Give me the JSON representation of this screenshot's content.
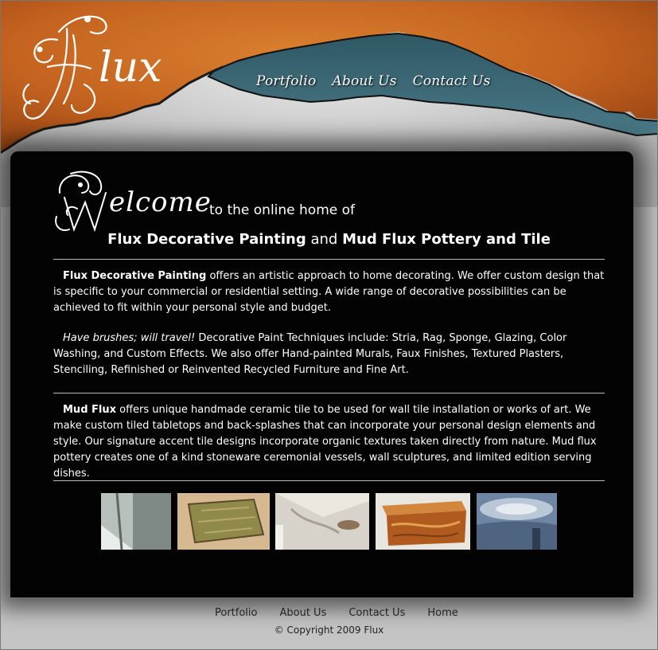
{
  "logo": {
    "text": "Flux",
    "initial": "F",
    "rest": "lux"
  },
  "nav": {
    "items": [
      {
        "label": "Portfolio"
      },
      {
        "label": "About Us"
      },
      {
        "label": "Contact Us"
      }
    ]
  },
  "welcome": {
    "initial": "W",
    "word": "elcome",
    "tail": "to the online home of"
  },
  "headline": {
    "name1": "Flux Decorative Painting",
    "and": "and",
    "name2": "Mud Flux Pottery and Tile"
  },
  "paragraphs": {
    "p1_bold": "Flux Decorative Painting",
    "p1_text": " offers an artistic approach to home decorating. We offer custom design that is specific to your commercial or residential setting. A wide range of decorative possibilities can be achieved to fit within your personal style and budget.",
    "p2_italic": "Have brushes; will travel!",
    "p2_text": " Decorative Paint Techniques include: Stria, Rag, Sponge, Glazing, Color Washing, and Custom Effects. We also offer Hand-painted Murals, Faux Finishes, Textured Plasters, Stenciling, Refinished or Reinvented Recycled Furniture and Fine Art.",
    "p3_bold": "Mud Flux",
    "p3_text": " offers unique handmade ceramic tile to be used for wall tile installation or works of art. We make custom tiled tabletops and back-splashes that can incorporate your personal design elements and style. Our signature accent tile designs incorporate organic textures taken directly from nature. Mud flux pottery creates one of a kind stoneware ceremonial vessels, wall sculptures, and limited edition serving dishes."
  },
  "thumbnails": [
    {
      "name": "stairway-wall-finish"
    },
    {
      "name": "ceramic-tile-piece"
    },
    {
      "name": "mural-ceiling-light"
    },
    {
      "name": "painted-wood-chest"
    },
    {
      "name": "sky-mural-room"
    }
  ],
  "footer": {
    "links": [
      {
        "label": "Portfolio"
      },
      {
        "label": "About Us"
      },
      {
        "label": "Contact Us"
      },
      {
        "label": "Home"
      }
    ],
    "copyright": "© Copyright 2009 Flux"
  },
  "colors": {
    "orange": "#c96b26",
    "teal": "#3e6a77",
    "panel": "#030303",
    "footer_bg": "#c4c4c4"
  }
}
